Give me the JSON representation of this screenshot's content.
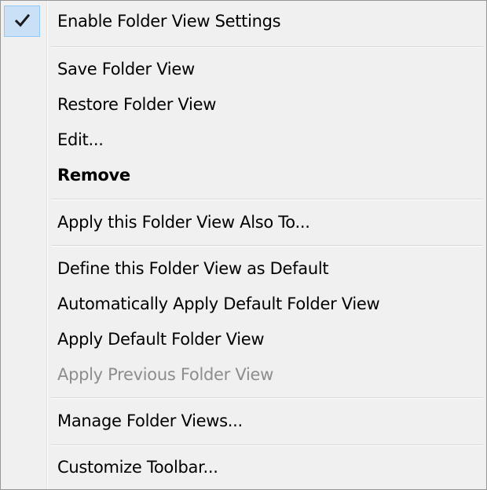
{
  "menu": {
    "items": [
      {
        "id": "enable-folder-view-settings",
        "label": "Enable Folder View Settings",
        "checked": true
      },
      {
        "id": "save-folder-view",
        "label": "Save Folder View"
      },
      {
        "id": "restore-folder-view",
        "label": "Restore Folder View"
      },
      {
        "id": "edit",
        "label": "Edit..."
      },
      {
        "id": "remove",
        "label": "Remove",
        "bold": true
      },
      {
        "id": "apply-folder-view-also-to",
        "label": "Apply this Folder View Also To..."
      },
      {
        "id": "define-default",
        "label": "Define this Folder View as Default"
      },
      {
        "id": "auto-apply-default",
        "label": "Automatically Apply Default Folder View"
      },
      {
        "id": "apply-default",
        "label": "Apply Default Folder View"
      },
      {
        "id": "apply-previous",
        "label": "Apply Previous Folder View",
        "disabled": true
      },
      {
        "id": "manage-folder-views",
        "label": "Manage Folder Views..."
      },
      {
        "id": "customize-toolbar",
        "label": "Customize Toolbar..."
      }
    ]
  },
  "icons": {
    "checkmark": "checkmark-icon"
  },
  "colors": {
    "menu_background": "#f0f0f0",
    "check_highlight": "#c9e0f7",
    "check_border": "#90c8f6",
    "disabled_text": "#8d8d8d"
  }
}
